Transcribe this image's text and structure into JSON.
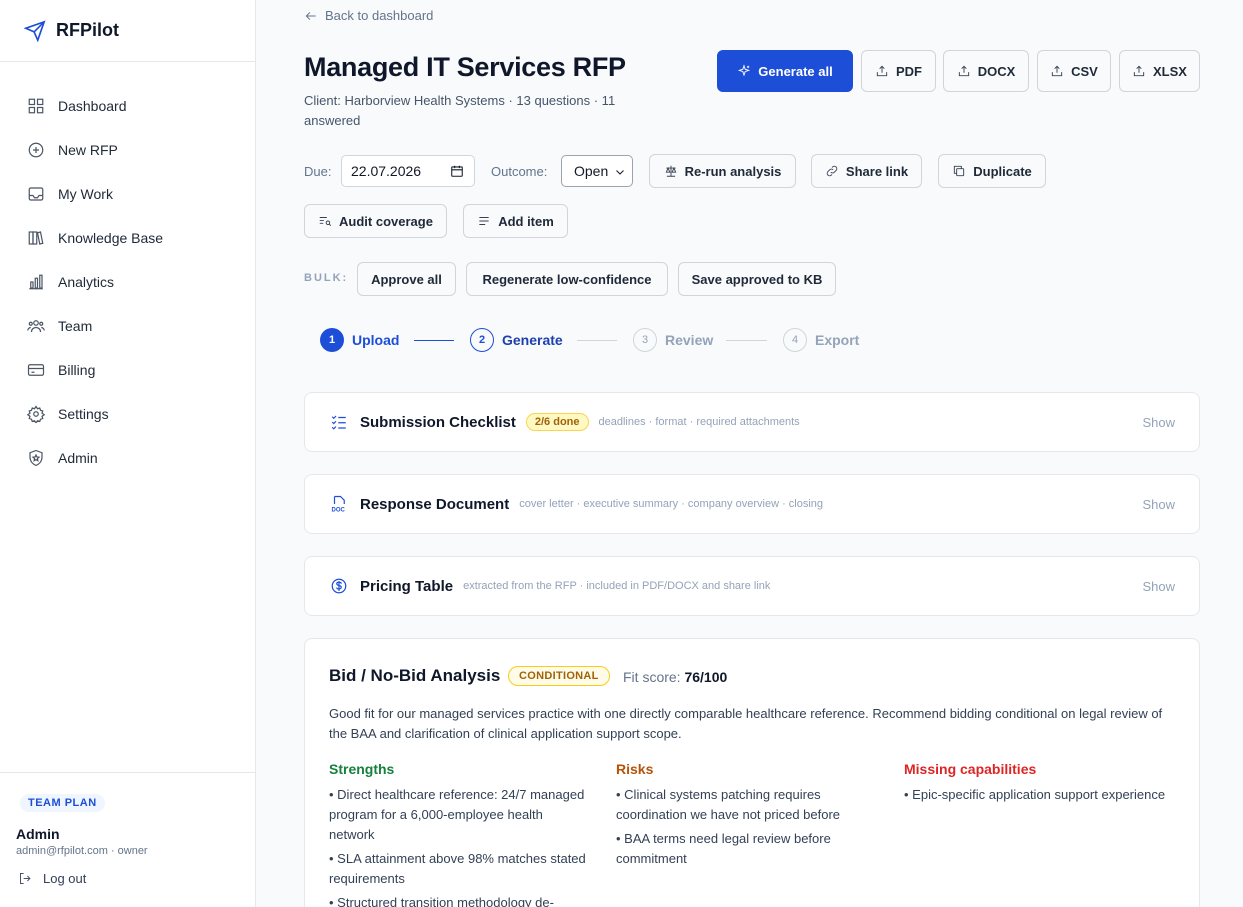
{
  "brand": {
    "name": "RFPilot"
  },
  "sidebar": {
    "items": [
      {
        "label": "Dashboard"
      },
      {
        "label": "New RFP"
      },
      {
        "label": "My Work"
      },
      {
        "label": "Knowledge Base"
      },
      {
        "label": "Analytics"
      },
      {
        "label": "Team"
      },
      {
        "label": "Billing"
      },
      {
        "label": "Settings"
      },
      {
        "label": "Admin"
      }
    ],
    "plan": "TEAM PLAN",
    "user_name": "Admin",
    "user_meta": "admin@rfpilot.com · owner",
    "logout": "Log out"
  },
  "header": {
    "back": "Back to dashboard",
    "title": "Managed IT Services RFP",
    "subtitle": "Client: Harborview Health Systems · 13 questions · 11 answered",
    "generate_all": "Generate all",
    "exports": [
      "PDF",
      "DOCX",
      "CSV",
      "XLSX"
    ]
  },
  "controls": {
    "due_label": "Due:",
    "due_value": "22.07.2026",
    "outcome_label": "Outcome:",
    "outcome_value": "Open",
    "rerun": "Re-run analysis",
    "share": "Share link",
    "duplicate": "Duplicate",
    "audit": "Audit coverage",
    "add_item": "Add item"
  },
  "bulk": {
    "label": "BULK:",
    "approve_all": "Approve all",
    "regenerate": "Regenerate low-confidence",
    "save_kb": "Save approved to KB"
  },
  "steps": [
    {
      "num": "1",
      "label": "Upload",
      "state": "done"
    },
    {
      "num": "2",
      "label": "Generate",
      "state": "active"
    },
    {
      "num": "3",
      "label": "Review",
      "state": "pending"
    },
    {
      "num": "4",
      "label": "Export",
      "state": "pending"
    }
  ],
  "sections": {
    "checklist": {
      "title": "Submission Checklist",
      "badge": "2/6 done",
      "hint": "deadlines · format · required attachments",
      "action": "Show"
    },
    "response": {
      "title": "Response Document",
      "hint": "cover letter · executive summary · company overview · closing",
      "action": "Show"
    },
    "pricing": {
      "title": "Pricing Table",
      "hint": "extracted from the RFP · included in PDF/DOCX and share link",
      "action": "Show"
    }
  },
  "analysis": {
    "title": "Bid / No-Bid Analysis",
    "verdict": "CONDITIONAL",
    "fit_label": "Fit score:",
    "fit_value": "76/100",
    "summary": "Good fit for our managed services practice with one directly comparable healthcare reference. Recommend bidding conditional on legal review of the BAA and clarification of clinical application support scope.",
    "strengths_title": "Strengths",
    "strengths": [
      "• Direct healthcare reference: 24/7 managed program for a 6,000-employee health network",
      "• SLA attainment above 98% matches stated requirements",
      "• Structured transition methodology de-"
    ],
    "risks_title": "Risks",
    "risks": [
      "• Clinical systems patching requires coordination we have not priced before",
      "• BAA terms need legal review before commitment"
    ],
    "missing_title": "Missing capabilities",
    "missing": [
      "• Epic-specific application support experience"
    ],
    "colors": {
      "strengths": "#15803d",
      "risks": "#b45309",
      "missing": "#dc2626"
    }
  }
}
